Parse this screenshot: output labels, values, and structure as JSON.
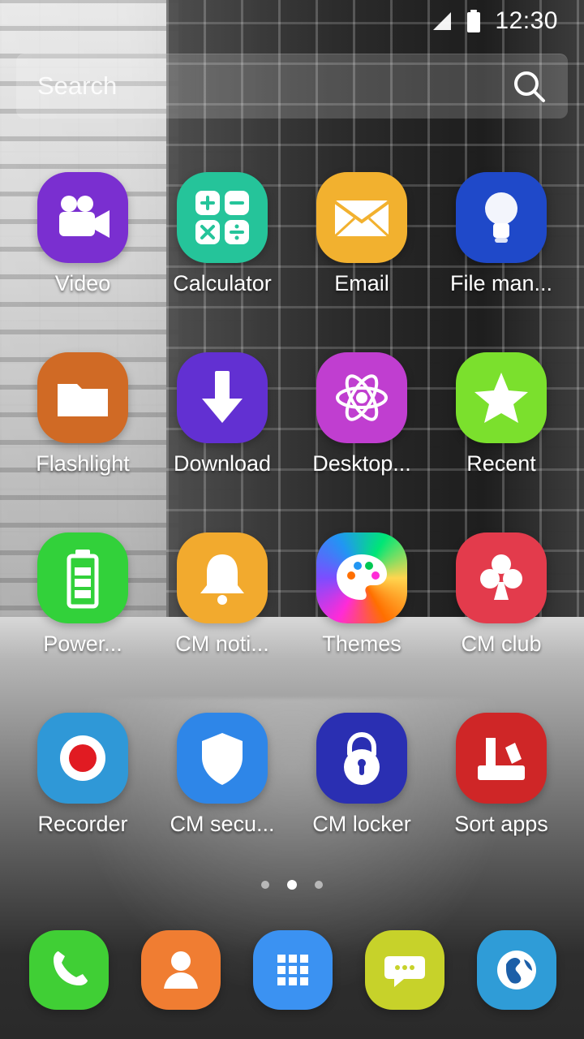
{
  "status_bar": {
    "time": "12:30"
  },
  "search": {
    "placeholder": "Search"
  },
  "apps": [
    {
      "label": "Video",
      "color": "#7a2fd0",
      "icon": "video-camera-icon"
    },
    {
      "label": "Calculator",
      "color": "#25c49a",
      "icon": "calculator-icon"
    },
    {
      "label": "Email",
      "color": "#f2b12f",
      "icon": "envelope-icon"
    },
    {
      "label": "File man...",
      "color": "#1f49c9",
      "icon": "lightbulb-icon"
    },
    {
      "label": "Flashlight",
      "color": "#d06a25",
      "icon": "folder-icon"
    },
    {
      "label": "Download",
      "color": "#6230d2",
      "icon": "download-arrow-icon"
    },
    {
      "label": "Desktop...",
      "color": "#c03ed0",
      "icon": "atom-icon"
    },
    {
      "label": "Recent",
      "color": "#7be02d",
      "icon": "star-icon"
    },
    {
      "label": "Power...",
      "color": "#32d13a",
      "icon": "battery-icon"
    },
    {
      "label": "CM noti...",
      "color": "#f2aa2e",
      "icon": "bell-icon"
    },
    {
      "label": "Themes",
      "color": "#ff6f2b",
      "icon": "palette-icon"
    },
    {
      "label": "CM club",
      "color": "#e33b4c",
      "icon": "club-icon"
    },
    {
      "label": "Recorder",
      "color": "#2f98d7",
      "icon": "record-icon"
    },
    {
      "label": "CM secu...",
      "color": "#2e86e8",
      "icon": "shield-icon"
    },
    {
      "label": "CM locker",
      "color": "#2a2fb2",
      "icon": "padlock-icon"
    },
    {
      "label": "Sort apps",
      "color": "#cf2627",
      "icon": "sort-apps-icon"
    }
  ],
  "pager": {
    "count": 3,
    "active_index": 1
  },
  "dock": [
    {
      "name": "phone",
      "color": "#40cf35",
      "icon": "phone-icon"
    },
    {
      "name": "contacts",
      "color": "#f07d32",
      "icon": "contact-icon"
    },
    {
      "name": "app-drawer",
      "color": "#3b92f2",
      "icon": "grid-icon"
    },
    {
      "name": "messages",
      "color": "#c7d22a",
      "icon": "chat-bubble-icon"
    },
    {
      "name": "browser",
      "color": "#2f9cd7",
      "icon": "globe-icon"
    }
  ]
}
